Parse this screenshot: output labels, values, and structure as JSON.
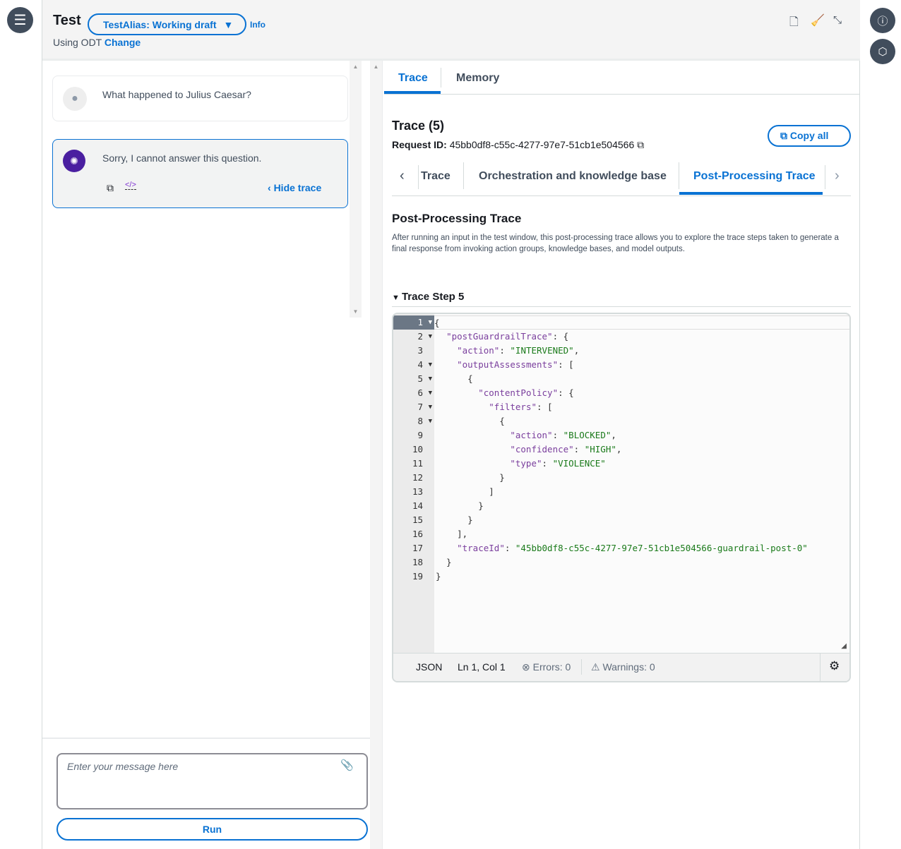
{
  "header": {
    "title": "Test",
    "alias_select": "TestAlias: Working draft",
    "info_link": "Info",
    "using_text": "Using ODT",
    "change_link": "Change"
  },
  "header_icons": [
    "document-icon",
    "clear-broom-icon",
    "minimize-icon"
  ],
  "right_rail_icons": [
    "info-icon",
    "settings-hex-icon"
  ],
  "chat": {
    "messages": [
      {
        "role": "user",
        "text": "What happened to Julius Caesar?"
      },
      {
        "role": "agent",
        "text": "Sorry, I cannot answer this question.",
        "hide_trace": "Hide trace"
      }
    ],
    "input_placeholder": "Enter your message here",
    "run_label": "Run"
  },
  "panel": {
    "tabs": [
      {
        "label": "Trace",
        "active": true
      },
      {
        "label": "Memory",
        "active": false
      }
    ],
    "trace_title": "Trace (5)",
    "request_id_label": "Request ID:",
    "request_id": "45bb0df8-c55c-4277-97e7-51cb1e504566",
    "copy_all": "Copy all",
    "subtabs": [
      {
        "label": "Trace",
        "active": false
      },
      {
        "label": "Orchestration and knowledge base",
        "active": false
      },
      {
        "label": "Post-Processing Trace",
        "active": true
      }
    ],
    "section_title": "Post-Processing Trace",
    "section_desc": "After running an input in the test window, this post-processing trace allows you to explore the trace steps taken to generate a final response from invoking action groups, knowledge bases, and model outputs.",
    "step_title": "Trace Step 5"
  },
  "code": {
    "lines": [
      "{",
      "  \"postGuardrailTrace\": {",
      "    \"action\": \"INTERVENED\",",
      "    \"outputAssessments\": [",
      "      {",
      "        \"contentPolicy\": {",
      "          \"filters\": [",
      "            {",
      "              \"action\": \"BLOCKED\",",
      "              \"confidence\": \"HIGH\",",
      "              \"type\": \"VIOLENCE\"",
      "            }",
      "          ]",
      "        }",
      "      }",
      "    ],",
      "    \"traceId\": \"45bb0df8-c55c-4277-97e7-51cb1e504566-guardrail-post-0\"",
      "  }",
      "}"
    ],
    "foldable": [
      1,
      2,
      4,
      5,
      6,
      7,
      8
    ],
    "status": {
      "language": "JSON",
      "position": "Ln 1, Col 1",
      "errors": "Errors: 0",
      "warnings": "Warnings: 0"
    }
  },
  "colors": {
    "accent": "#0972d3",
    "key": "#7a3e9d",
    "string": "#1a7a1a"
  }
}
